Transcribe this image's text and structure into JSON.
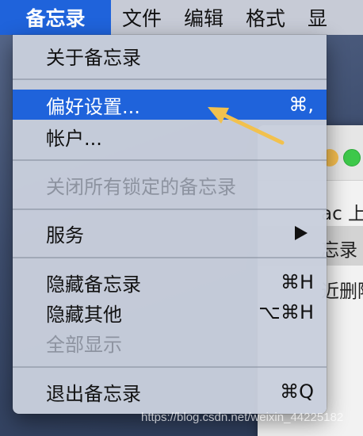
{
  "menubar": {
    "items": [
      {
        "label": "备忘录"
      },
      {
        "label": "文件"
      },
      {
        "label": "编辑"
      },
      {
        "label": "格式"
      },
      {
        "label": "显"
      }
    ]
  },
  "background_window": {
    "texts": [
      "ac 上",
      "忘录",
      "近删除"
    ]
  },
  "menu": {
    "about": "关于备忘录",
    "preferences": {
      "label": "偏好设置...",
      "shortcut": "⌘,"
    },
    "accounts": "帐户...",
    "close_locked": "关闭所有锁定的备忘录",
    "services": "服务",
    "hide": {
      "label": "隐藏备忘录",
      "shortcut": "⌘H"
    },
    "hide_others": {
      "label": "隐藏其他",
      "shortcut": "⌥⌘H"
    },
    "show_all": "全部显示",
    "quit": {
      "label": "退出备忘录",
      "shortcut": "⌘Q"
    }
  },
  "colors": {
    "highlight": "#1f63db",
    "annotation_arrow": "#f2c14e"
  },
  "watermark": "https://blog.csdn.net/weixin_44225182"
}
